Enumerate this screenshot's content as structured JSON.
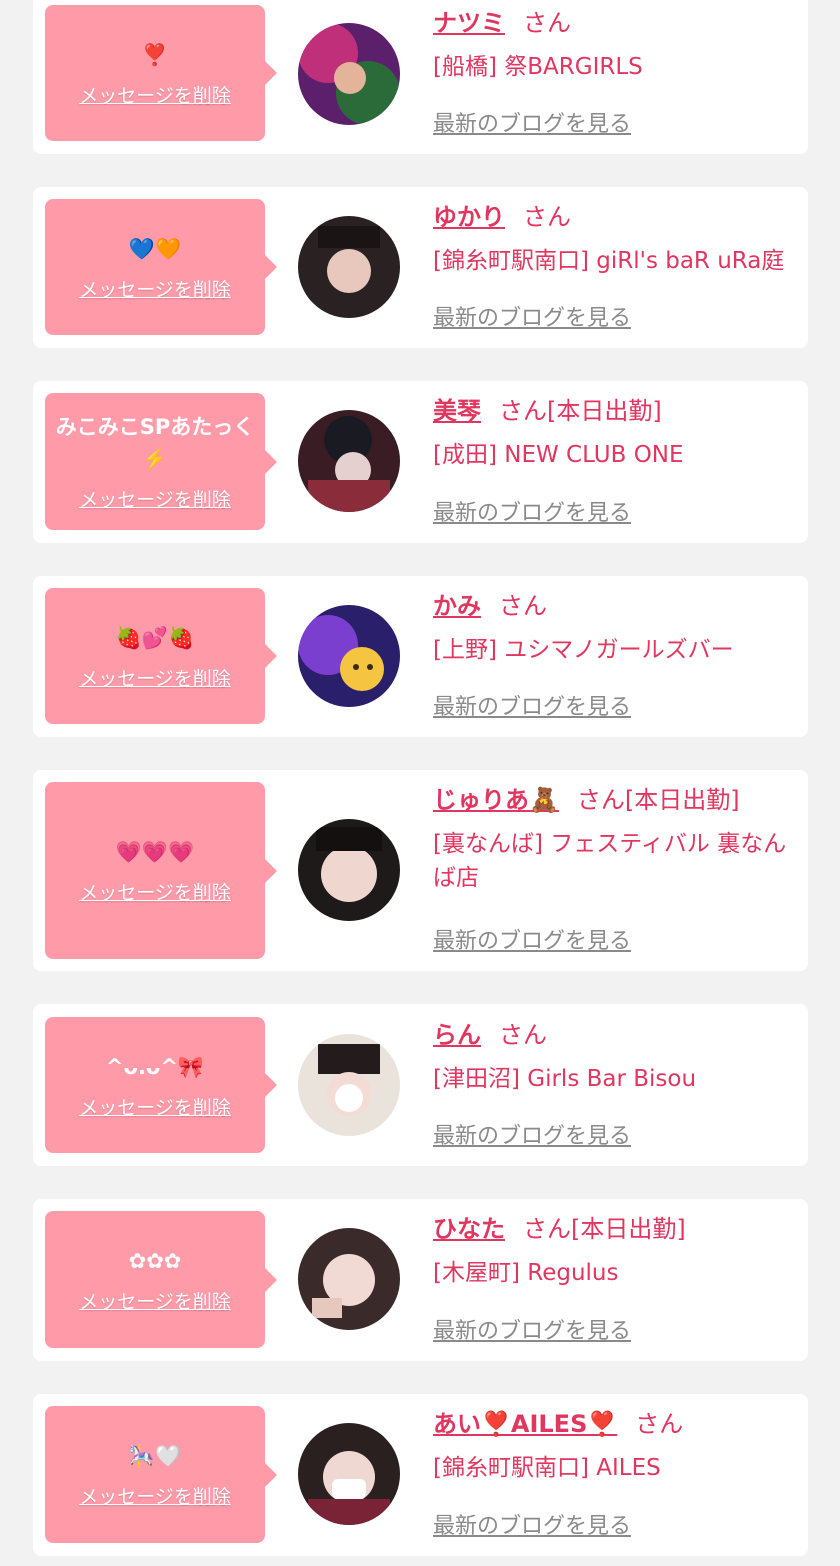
{
  "delete_label": "メッセージを削除",
  "blog_label": "最新のブログを見る",
  "honorific": "さん",
  "colors": {
    "accent": "#e0365f",
    "bubble": "#ff9aa9",
    "muted": "#8a8a8a"
  },
  "cards": [
    {
      "message": "❣️",
      "name": "ナツミ",
      "status": "",
      "shop": "[船橋] 祭BARGIRLS"
    },
    {
      "message": "💙🧡",
      "name": "ゆかり",
      "status": "",
      "shop": "[錦糸町駅南口] giRl's baR uRa庭"
    },
    {
      "message": "みこみこSPあたっく⚡️",
      "name": "美琴",
      "status": "[本日出勤]",
      "shop": "[成田] NEW CLUB ONE"
    },
    {
      "message": "🍓💕🍓",
      "name": "かみ",
      "status": "",
      "shop": "[上野] ユシマノガールズバー"
    },
    {
      "message": "💗💗💗",
      "name": "じゅりあ🧸",
      "status": "[本日出勤]",
      "shop": "[裏なんば] フェスティバル 裏なんば店"
    },
    {
      "message": "^ᴗ.ᴗ^🎀",
      "name": "らん",
      "status": "",
      "shop": "[津田沼] Girls Bar Bisou"
    },
    {
      "message": "✿✿✿",
      "name": "ひなた",
      "status": "[本日出勤]",
      "shop": "[木屋町] Regulus"
    },
    {
      "message": "🎠🤍",
      "name": "あい❣️AILES❣️",
      "status": "",
      "shop": "[錦糸町駅南口] AILES"
    }
  ]
}
